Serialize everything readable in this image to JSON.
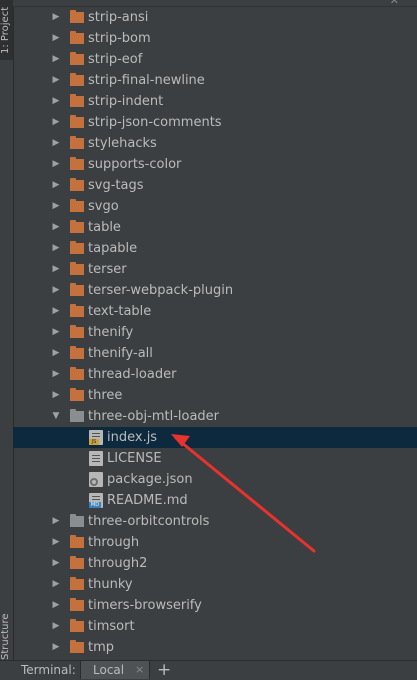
{
  "side_tabs": {
    "project": "1: Project",
    "structure": "Structure"
  },
  "tree": {
    "rows": [
      {
        "label": "strip-ansi",
        "kind": "folder",
        "expanded": false
      },
      {
        "label": "strip-bom",
        "kind": "folder",
        "expanded": false
      },
      {
        "label": "strip-eof",
        "kind": "folder",
        "expanded": false
      },
      {
        "label": "strip-final-newline",
        "kind": "folder",
        "expanded": false
      },
      {
        "label": "strip-indent",
        "kind": "folder",
        "expanded": false
      },
      {
        "label": "strip-json-comments",
        "kind": "folder",
        "expanded": false
      },
      {
        "label": "stylehacks",
        "kind": "folder",
        "expanded": false
      },
      {
        "label": "supports-color",
        "kind": "folder",
        "expanded": false
      },
      {
        "label": "svg-tags",
        "kind": "folder",
        "expanded": false
      },
      {
        "label": "svgo",
        "kind": "folder",
        "expanded": false
      },
      {
        "label": "table",
        "kind": "folder",
        "expanded": false
      },
      {
        "label": "tapable",
        "kind": "folder",
        "expanded": false
      },
      {
        "label": "terser",
        "kind": "folder",
        "expanded": false
      },
      {
        "label": "terser-webpack-plugin",
        "kind": "folder",
        "expanded": false
      },
      {
        "label": "text-table",
        "kind": "folder",
        "expanded": false
      },
      {
        "label": "thenify",
        "kind": "folder",
        "expanded": false
      },
      {
        "label": "thenify-all",
        "kind": "folder",
        "expanded": false
      },
      {
        "label": "thread-loader",
        "kind": "folder",
        "expanded": false
      },
      {
        "label": "three",
        "kind": "folder",
        "expanded": false
      },
      {
        "label": "three-obj-mtl-loader",
        "kind": "folder-open",
        "expanded": true
      },
      {
        "label": "index.js",
        "kind": "file-js",
        "selected": true
      },
      {
        "label": "LICENSE",
        "kind": "file-txt"
      },
      {
        "label": "package.json",
        "kind": "file-json"
      },
      {
        "label": "README.md",
        "kind": "file-md"
      },
      {
        "label": "three-orbitcontrols",
        "kind": "folder-grey",
        "expanded": false
      },
      {
        "label": "through",
        "kind": "folder",
        "expanded": false
      },
      {
        "label": "through2",
        "kind": "folder",
        "expanded": false
      },
      {
        "label": "thunky",
        "kind": "folder",
        "expanded": false
      },
      {
        "label": "timers-browserify",
        "kind": "folder",
        "expanded": false
      },
      {
        "label": "timsort",
        "kind": "folder",
        "expanded": false
      },
      {
        "label": "tmp",
        "kind": "folder",
        "expanded": false
      }
    ]
  },
  "terminal": {
    "label": "Terminal:",
    "tab_label": "Local",
    "close_icon": "×",
    "new_tab_icon": "+"
  },
  "icons": {
    "expand_collapsed": "chevron-right-icon",
    "expand_open": "chevron-down-icon",
    "folder": "folder-icon"
  },
  "colors": {
    "background": "#3c3f41",
    "selection": "#0d293e",
    "folder_orange": "#c5713e",
    "folder_grey": "#8a8e91",
    "annotation_arrow": "#e8322e"
  }
}
